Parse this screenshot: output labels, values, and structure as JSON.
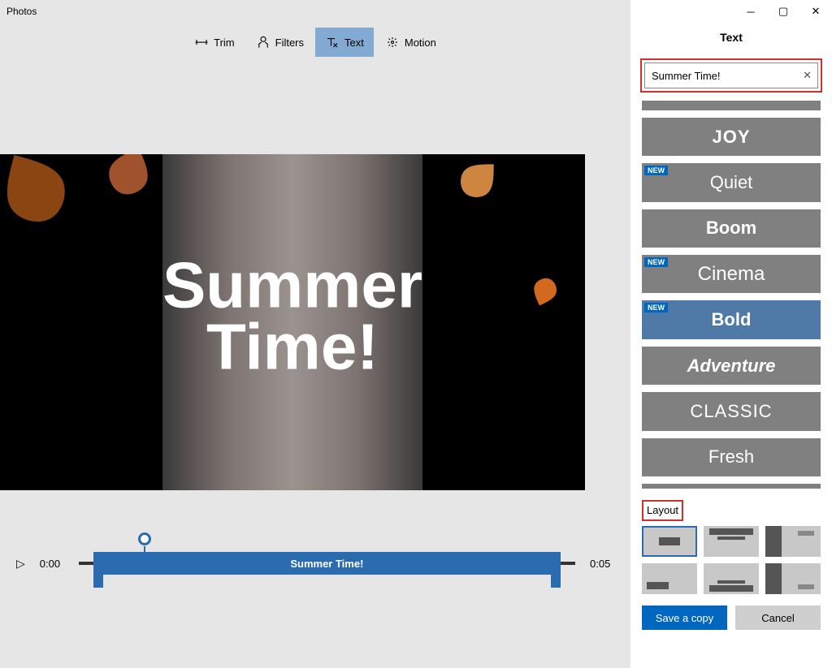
{
  "app_title": "Photos",
  "toolbar": {
    "trim": "Trim",
    "filters": "Filters",
    "text": "Text",
    "motion": "Motion"
  },
  "preview": {
    "overlay_text_line1": "Summer",
    "overlay_text_line2": "Time!"
  },
  "timeline": {
    "start": "0:00",
    "end": "0:05",
    "clip_label": "Summer Time!"
  },
  "panel": {
    "title": "Text",
    "input_value": "Summer Time!",
    "new_badge": "NEW",
    "styles": [
      {
        "label": "JOY",
        "class": "st-joy",
        "new": false
      },
      {
        "label": "Quiet",
        "class": "st-quiet",
        "new": true
      },
      {
        "label": "Boom",
        "class": "st-boom",
        "new": false
      },
      {
        "label": "Cinema",
        "class": "st-cinema",
        "new": true
      },
      {
        "label": "Bold",
        "class": "",
        "new": true,
        "selected": true
      },
      {
        "label": "Adventure",
        "class": "st-adventure",
        "new": false
      },
      {
        "label": "CLASSIC",
        "class": "st-classic",
        "new": false
      },
      {
        "label": "Fresh",
        "class": "st-fresh",
        "new": false
      }
    ],
    "layout_label": "Layout",
    "save_label": "Save a copy",
    "cancel_label": "Cancel"
  }
}
